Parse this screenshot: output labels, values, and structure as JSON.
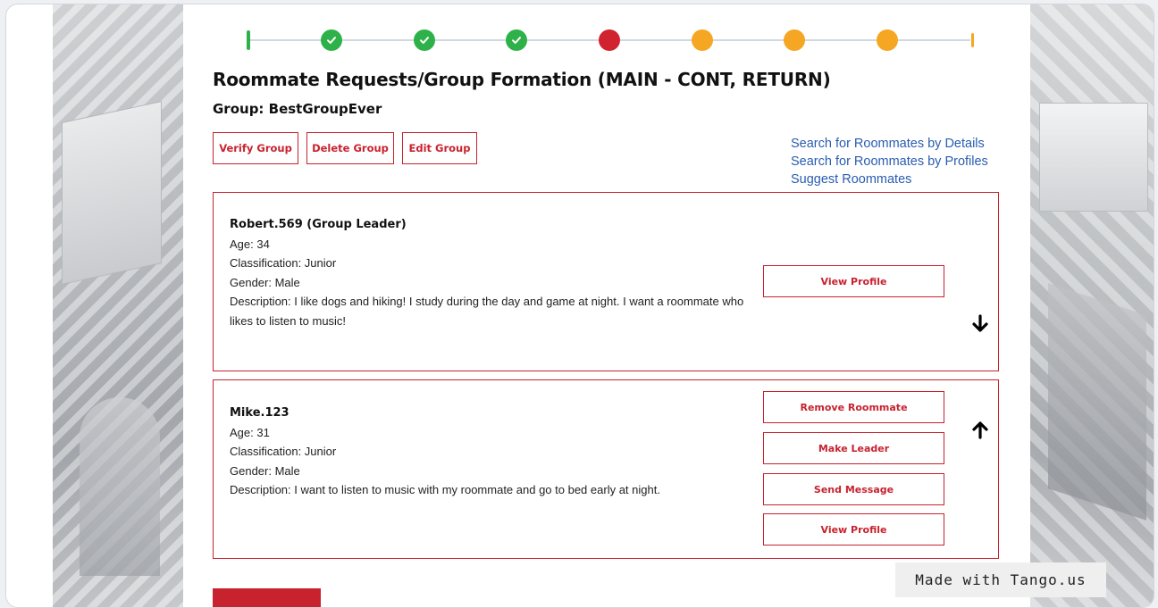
{
  "progress": {
    "steps": [
      "partial",
      "done",
      "done",
      "done",
      "current",
      "todo",
      "todo",
      "todo",
      "partial"
    ],
    "colors": {
      "done": "#2fb14a",
      "current": "#d0222f",
      "todo": "#f5a623"
    }
  },
  "page": {
    "title": "Roommate Requests/Group Formation (MAIN - CONT, RETURN)",
    "group_label": "Group: BestGroupEver"
  },
  "actions": {
    "verify": "Verify Group",
    "delete": "Delete Group",
    "edit": "Edit Group"
  },
  "links": {
    "search_details": "Search for Roommates by Details",
    "search_profiles": "Search for Roommates by Profiles",
    "suggest": "Suggest Roommates"
  },
  "members": [
    {
      "name": "Robert.569 (Group Leader)",
      "age": "Age: 34",
      "classification": "Classification: Junior",
      "gender": "Gender: Male",
      "description": "Description: I like dogs and hiking! I study during the day and game at night. I want a roommate who likes to listen to music!",
      "buttons": {
        "view_profile": "View Profile"
      },
      "arrow": "arrow-down"
    },
    {
      "name": "Mike.123",
      "age": "Age: 31",
      "classification": "Classification: Junior",
      "gender": "Gender: Male",
      "description": "Description: I want to listen to music with my roommate and go to bed early at night.",
      "buttons": {
        "remove": "Remove Roommate",
        "make_leader": "Make Leader",
        "send_message": "Send Message",
        "view_profile": "View Profile"
      },
      "arrow": "arrow-up"
    }
  ],
  "watermark": "Made with Tango.us",
  "accent_color": "#c8222e",
  "link_color": "#2a5db0"
}
